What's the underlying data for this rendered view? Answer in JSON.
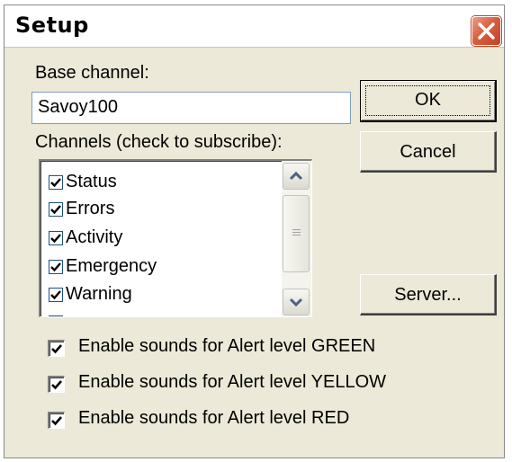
{
  "window": {
    "title": "Setup",
    "close_icon": "close-icon",
    "background": "#ece9d8",
    "close_color": "#d9603e"
  },
  "base_channel": {
    "label": "Base channel:",
    "value": "Savoy100"
  },
  "channels": {
    "label": "Channels (check to subscribe):",
    "items": [
      {
        "label": "Status",
        "checked": true
      },
      {
        "label": "Errors",
        "checked": true
      },
      {
        "label": "Activity",
        "checked": true
      },
      {
        "label": "Emergency",
        "checked": true
      },
      {
        "label": "Warning",
        "checked": true
      }
    ],
    "scroll_up_icon": "chevron-up-icon",
    "scroll_down_icon": "chevron-down-icon"
  },
  "buttons": {
    "ok": "OK",
    "cancel": "Cancel",
    "server": "Server..."
  },
  "alerts": [
    {
      "label": "Enable sounds for Alert level GREEN",
      "checked": true
    },
    {
      "label": "Enable sounds for Alert level YELLOW",
      "checked": true
    },
    {
      "label": "Enable sounds for Alert level RED",
      "checked": true
    }
  ]
}
